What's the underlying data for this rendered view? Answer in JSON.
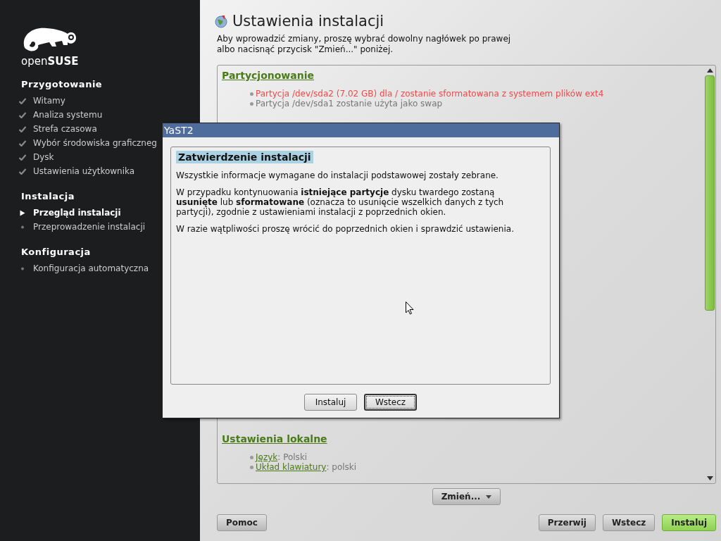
{
  "sidebar": {
    "logo": "open**SUSE**",
    "sections": [
      {
        "title": "Przygotowanie",
        "items": [
          {
            "label": "Witamy",
            "kind": "done"
          },
          {
            "label": "Analiza systemu",
            "kind": "done"
          },
          {
            "label": "Strefa czasowa",
            "kind": "done"
          },
          {
            "label": "Wybór środowiska graficzneg",
            "kind": "done"
          },
          {
            "label": "Dysk",
            "kind": "done"
          },
          {
            "label": "Ustawienia użytkownika",
            "kind": "done"
          }
        ]
      },
      {
        "title": "Instalacja",
        "items": [
          {
            "label": "Przegląd instalacji",
            "kind": "current"
          },
          {
            "label": "Przeprowadzenie instalacji",
            "kind": "pending"
          }
        ]
      },
      {
        "title": "Konfiguracja",
        "items": [
          {
            "label": "Konfiguracja automatyczna",
            "kind": "pending"
          }
        ]
      }
    ]
  },
  "page": {
    "title": "Ustawienia instalacji",
    "description": "Aby wprowadzić zmiany, proszę wybrać dowolny nagłówek po prawej\nalbo nacisnąć przycisk \"Zmień...\" poniżej.",
    "summary": [
      {
        "heading": "Partycjonowanie",
        "items": [
          {
            "text": "Partycja /dev/sda2 (7.02 GB) dla / zostanie sformatowana z systemem plików ext4",
            "warning": true
          },
          {
            "text": "Partycja /dev/sda1 zostanie użyta jako swap",
            "warning": false
          }
        ]
      },
      {
        "heading": "Ustawienia lokalne",
        "items": [
          {
            "link": "Język",
            "value": ": Polski",
            "warning": false
          },
          {
            "link": "Układ klawiatury",
            "value": ": polski",
            "warning": false
          }
        ]
      }
    ],
    "change_button": {
      "label": "Zmień..."
    }
  },
  "buttons": [
    {
      "label": "Pomoc",
      "primary": false
    },
    {
      "label": "Przerwij",
      "primary": false
    },
    {
      "label": "Wstecz",
      "primary": false
    },
    {
      "label": "Instaluj",
      "primary": true
    }
  ],
  "dialog": {
    "title": "YaST2",
    "heading": "Zatwierdzenie instalacji",
    "paragraphs": [
      "Wszystkie informacje wymagane do instalacji podstawowej zostały zebrane.",
      "W przypadku kontynuowania **istniejące partycje** dysku twardego zostaną\n**usunięte** lub **sformatowane** (oznacza to usunięcie wszelkich danych z tych\npartycji), zgodnie z ustawieniami instalacji z poprzednich okien.",
      "W razie wątpliwości proszę wrócić do poprzednich okien i sprawdzić ustawienia."
    ],
    "buttons": [
      {
        "label": "Instaluj",
        "focused": false
      },
      {
        "label": "Wstecz",
        "focused": true
      }
    ]
  }
}
